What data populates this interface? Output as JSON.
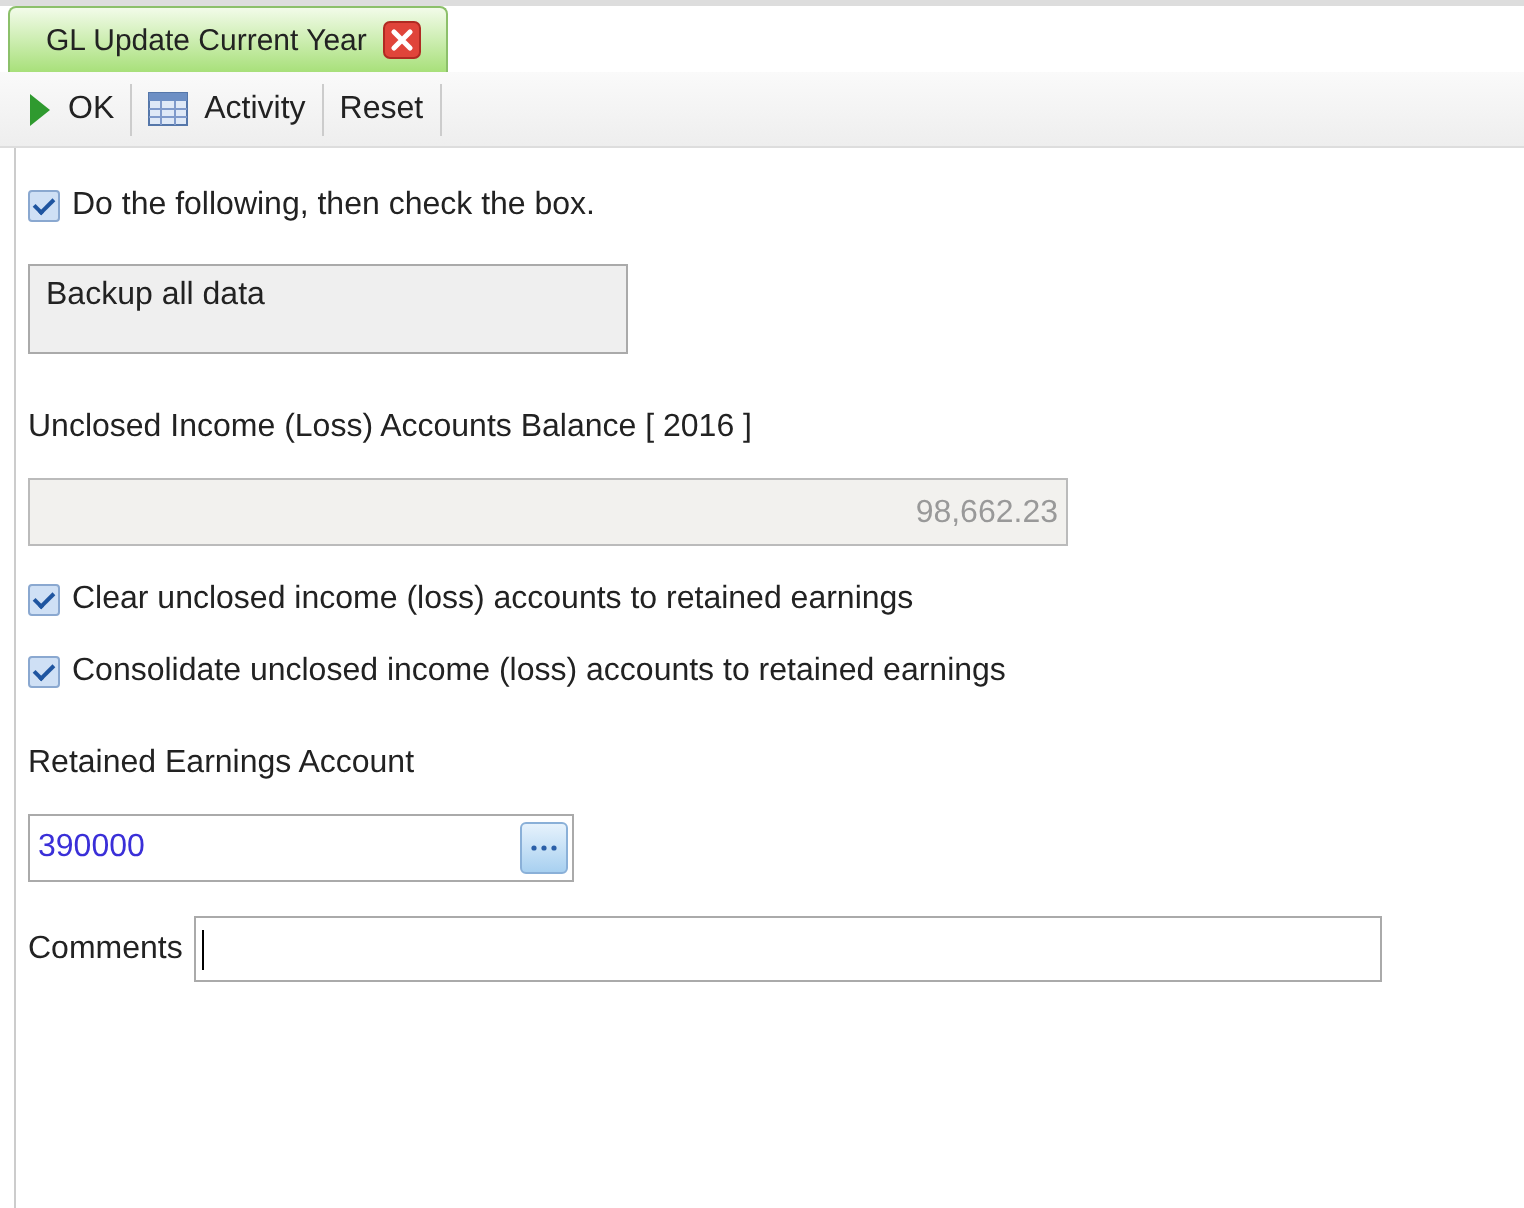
{
  "tab": {
    "title": "GL Update Current Year",
    "selected": true
  },
  "toolbar": [
    {
      "kind": "ok",
      "label": "OK"
    },
    {
      "kind": "activity",
      "label": "Activity"
    },
    {
      "kind": "reset",
      "label": "Reset"
    }
  ],
  "instruction": {
    "label": "Do the following, then check the box.",
    "checked": true
  },
  "task_box": {
    "text": "Backup all data"
  },
  "balance": {
    "label": "Unclosed Income (Loss) Accounts Balance [ 2016 ]",
    "value": "98,662.23"
  },
  "options": [
    {
      "label": "Clear unclosed income (loss) accounts to retained earnings",
      "checked": true
    },
    {
      "label": "Consolidate unclosed income (loss) accounts to retained earnings",
      "checked": true
    }
  ],
  "retained_earnings": {
    "label": "Retained Earnings Account",
    "value": "390000"
  },
  "comments": {
    "label": "Comments"
  }
}
